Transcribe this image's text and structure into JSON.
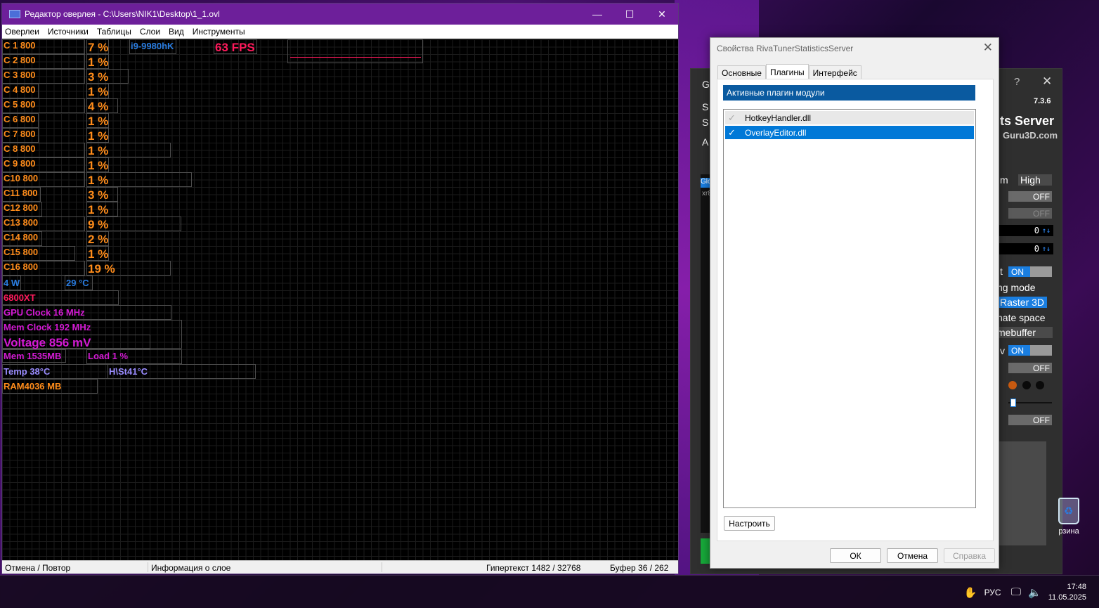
{
  "editor": {
    "title": "Редактор оверлея - C:\\Users\\NIK1\\Desktop\\1_1.ovl",
    "menu": [
      "Оверлеи",
      "Источники",
      "Таблицы",
      "Слои",
      "Вид",
      "Инструменты"
    ],
    "layers": {
      "cpu_clocks": [
        "C 1 800",
        "C 2 800",
        "C 3 800",
        "C 4 800",
        "C 5 800",
        "C 6 800",
        "C 7 800",
        "C 8 800",
        "C 9 800",
        "C10 800",
        "C11 800",
        "C12 800",
        "C13 800",
        "C14 800",
        "C15 800",
        "C16 800"
      ],
      "cpu_loads": [
        "7 %",
        "1 %",
        "3 %",
        "1 %",
        "4 %",
        "1 %",
        "1 %",
        "1 %",
        "1 %",
        "1 %",
        "3 %",
        "1 %",
        "9 %",
        "2 %",
        "1 %",
        "19 %"
      ],
      "cpu_name": "i9-9980hK",
      "fps": "63 FPS",
      "power": "4 W",
      "cpu_temp": "29 °C",
      "gpu_name": "6800XT",
      "gpu_clock": "GPU Clock 16 MHz",
      "mem_clock": "Mem Clock 192 MHz",
      "voltage": "Voltage 856 mV",
      "mem": "Mem 1535MB",
      "load": "Load 1 %",
      "temp": "Temp 38°C",
      "hotspot": "H\\St41°C",
      "ram": "RAM4036 MB"
    },
    "status": {
      "undo": "Отмена / Повтор",
      "layer_info": "Информация о слое",
      "hypertext": "Гипертекст 1482 / 32768",
      "buffer": "Буфер 36 / 262"
    }
  },
  "rtss_bg": {
    "version": "7.3.6",
    "server": "ts Server",
    "site": "Guru3D.com",
    "high_label": "High",
    "off": "OFF",
    "on": "ON",
    "counter_value": "0",
    "label_mode": "ng mode",
    "label_raster": "Raster 3D",
    "label_space": "nate space",
    "label_framebuffer": "mebuffer",
    "label_t": "t",
    "label_v": "v",
    "label_m": "m",
    "label_s1": "S",
    "label_s2": "S",
    "label_a": "A",
    "label_g": "G",
    "chip_text": "Glo",
    "chip_text2": "xr8"
  },
  "dialog": {
    "title": "Свойства RivaTunerStatisticsServer",
    "tabs": [
      "Основные",
      "Плагины",
      "Интерфейс"
    ],
    "header": "Активные плагин модули",
    "plugins": [
      {
        "name": "HotkeyHandler.dll",
        "checked": false
      },
      {
        "name": "OverlayEditor.dll",
        "checked": true
      }
    ],
    "configure_button": "Настроить",
    "ok": "ОК",
    "cancel": "Отмена",
    "help": "Справка"
  },
  "taskbar": {
    "lang": "РУС",
    "time": "17:48",
    "date": "11.05.2025"
  },
  "desktop": {
    "recycle_label": "рзина"
  }
}
